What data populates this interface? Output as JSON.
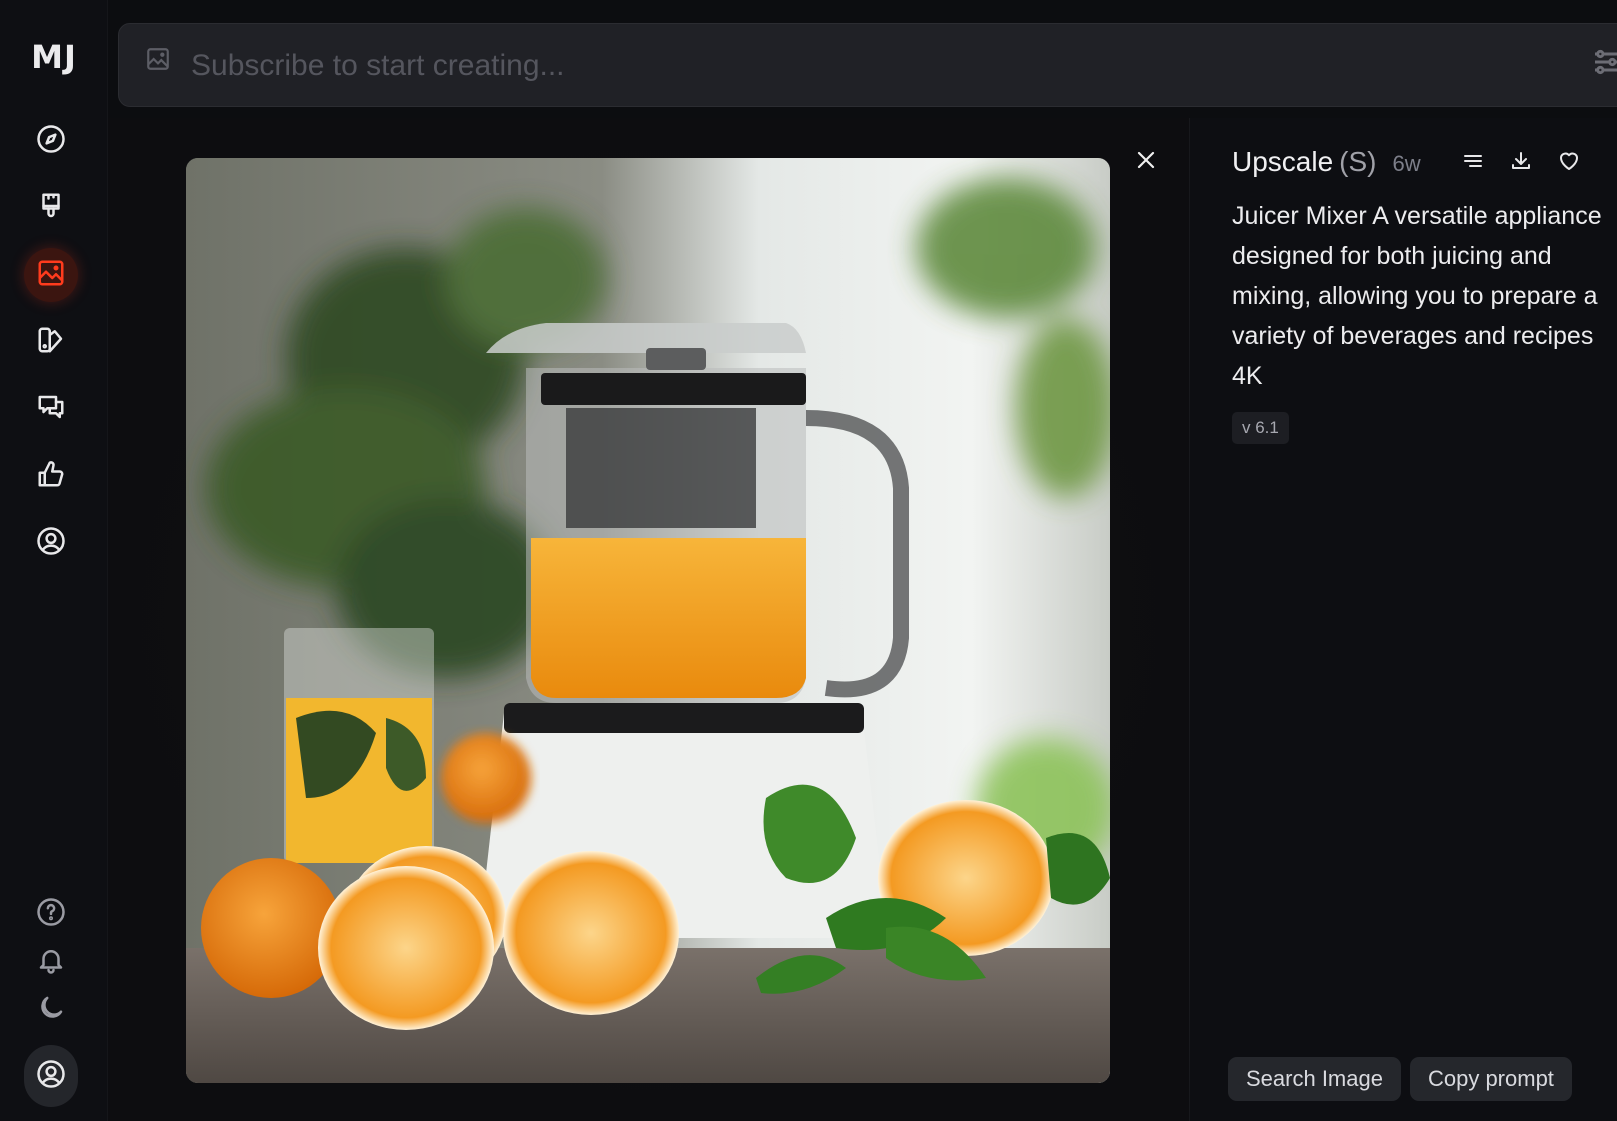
{
  "app": {
    "logo": "MJ"
  },
  "sidebar": {
    "items": [
      {
        "name": "explore",
        "icon": "compass-icon",
        "active": false
      },
      {
        "name": "create",
        "icon": "paintbrush-icon",
        "active": false
      },
      {
        "name": "organize",
        "icon": "image-icon",
        "active": true
      },
      {
        "name": "personalize",
        "icon": "palette-icon",
        "active": false
      },
      {
        "name": "chat",
        "icon": "chat-bubbles-icon",
        "active": false
      },
      {
        "name": "rank",
        "icon": "thumbs-up-icon",
        "active": false
      },
      {
        "name": "profile",
        "icon": "user-circle-icon",
        "active": false
      }
    ],
    "bottom_items": [
      {
        "name": "help",
        "icon": "question-circle-icon"
      },
      {
        "name": "notifications",
        "icon": "bell-icon"
      },
      {
        "name": "dark-mode",
        "icon": "moon-icon"
      },
      {
        "name": "account",
        "icon": "user-circle-icon"
      }
    ],
    "accent_color": "#ff3b1d"
  },
  "prompt_bar": {
    "placeholder": "Subscribe to start creating...",
    "value": ""
  },
  "viewer": {
    "image_alt": "White juicer mixer with orange juice, glass of juice, sliced oranges and basil leaves on a wooden table",
    "close_label": "close"
  },
  "detail_panel": {
    "title": "Upscale",
    "title_suffix": "(S)",
    "age": "6w",
    "actions": [
      {
        "name": "options",
        "icon": "lines-icon"
      },
      {
        "name": "download",
        "icon": "download-icon"
      },
      {
        "name": "like",
        "icon": "heart-icon"
      }
    ],
    "prompt": "Juicer Mixer A versatile appliance designed for both juicing and mixing, allowing you to prepare a variety of beverages and recipes 4K",
    "version": "v 6.1",
    "buttons": {
      "search_image": "Search Image",
      "copy_prompt": "Copy prompt"
    }
  }
}
